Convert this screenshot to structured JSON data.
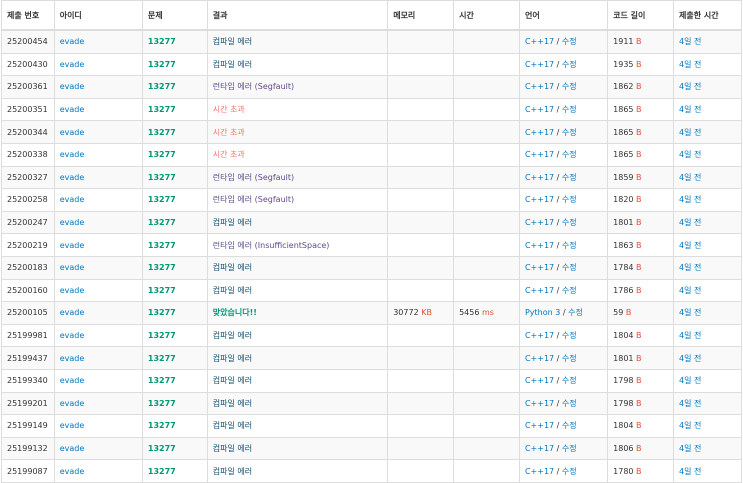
{
  "colors": {
    "compile_error": "#0f4d6d",
    "runtime_error": "#5f4b8b",
    "time_limit": "#fa7268",
    "accepted": "#009874",
    "problem": "#009874",
    "link": "#0076c0",
    "unit": "#e74c3c"
  },
  "headers": [
    "제출 번호",
    "아이디",
    "문제",
    "결과",
    "메모리",
    "시간",
    "언어",
    "코드 길이",
    "제출한 시간"
  ],
  "rows": [
    {
      "id": "25200454",
      "user": "evade",
      "problem": "13277",
      "result": "컴파일 에러",
      "type": "ce",
      "memory": "",
      "memory_unit": "",
      "time": "",
      "time_unit": "",
      "lang": "C++17",
      "edit": "수정",
      "len": "1911",
      "len_unit": "B",
      "ago": "4일 전"
    },
    {
      "id": "25200430",
      "user": "evade",
      "problem": "13277",
      "result": "컴파일 에러",
      "type": "ce",
      "memory": "",
      "memory_unit": "",
      "time": "",
      "time_unit": "",
      "lang": "C++17",
      "edit": "수정",
      "len": "1935",
      "len_unit": "B",
      "ago": "4일 전"
    },
    {
      "id": "25200361",
      "user": "evade",
      "problem": "13277",
      "result": "런타임 에러 (Segfault)",
      "type": "rte",
      "memory": "",
      "memory_unit": "",
      "time": "",
      "time_unit": "",
      "lang": "C++17",
      "edit": "수정",
      "len": "1862",
      "len_unit": "B",
      "ago": "4일 전"
    },
    {
      "id": "25200351",
      "user": "evade",
      "problem": "13277",
      "result": "시간 초과",
      "type": "tle",
      "memory": "",
      "memory_unit": "",
      "time": "",
      "time_unit": "",
      "lang": "C++17",
      "edit": "수정",
      "len": "1865",
      "len_unit": "B",
      "ago": "4일 전"
    },
    {
      "id": "25200344",
      "user": "evade",
      "problem": "13277",
      "result": "시간 초과",
      "type": "tle",
      "memory": "",
      "memory_unit": "",
      "time": "",
      "time_unit": "",
      "lang": "C++17",
      "edit": "수정",
      "len": "1865",
      "len_unit": "B",
      "ago": "4일 전"
    },
    {
      "id": "25200338",
      "user": "evade",
      "problem": "13277",
      "result": "시간 초과",
      "type": "tle",
      "memory": "",
      "memory_unit": "",
      "time": "",
      "time_unit": "",
      "lang": "C++17",
      "edit": "수정",
      "len": "1865",
      "len_unit": "B",
      "ago": "4일 전"
    },
    {
      "id": "25200327",
      "user": "evade",
      "problem": "13277",
      "result": "런타임 에러 (Segfault)",
      "type": "rte",
      "memory": "",
      "memory_unit": "",
      "time": "",
      "time_unit": "",
      "lang": "C++17",
      "edit": "수정",
      "len": "1859",
      "len_unit": "B",
      "ago": "4일 전"
    },
    {
      "id": "25200258",
      "user": "evade",
      "problem": "13277",
      "result": "런타임 에러 (Segfault)",
      "type": "rte",
      "memory": "",
      "memory_unit": "",
      "time": "",
      "time_unit": "",
      "lang": "C++17",
      "edit": "수정",
      "len": "1820",
      "len_unit": "B",
      "ago": "4일 전"
    },
    {
      "id": "25200247",
      "user": "evade",
      "problem": "13277",
      "result": "컴파일 에러",
      "type": "ce",
      "memory": "",
      "memory_unit": "",
      "time": "",
      "time_unit": "",
      "lang": "C++17",
      "edit": "수정",
      "len": "1801",
      "len_unit": "B",
      "ago": "4일 전"
    },
    {
      "id": "25200219",
      "user": "evade",
      "problem": "13277",
      "result": "런타임 에러 (InsufficientSpace)",
      "type": "rte",
      "memory": "",
      "memory_unit": "",
      "time": "",
      "time_unit": "",
      "lang": "C++17",
      "edit": "수정",
      "len": "1863",
      "len_unit": "B",
      "ago": "4일 전"
    },
    {
      "id": "25200183",
      "user": "evade",
      "problem": "13277",
      "result": "컴파일 에러",
      "type": "ce",
      "memory": "",
      "memory_unit": "",
      "time": "",
      "time_unit": "",
      "lang": "C++17",
      "edit": "수정",
      "len": "1784",
      "len_unit": "B",
      "ago": "4일 전"
    },
    {
      "id": "25200160",
      "user": "evade",
      "problem": "13277",
      "result": "컴파일 에러",
      "type": "ce",
      "memory": "",
      "memory_unit": "",
      "time": "",
      "time_unit": "",
      "lang": "C++17",
      "edit": "수정",
      "len": "1786",
      "len_unit": "B",
      "ago": "4일 전"
    },
    {
      "id": "25200105",
      "user": "evade",
      "problem": "13277",
      "result": "맞았습니다!!",
      "type": "ac",
      "memory": "30772",
      "memory_unit": "KB",
      "time": "5456",
      "time_unit": "ms",
      "lang": "Python 3",
      "edit": "수정",
      "len": "59",
      "len_unit": "B",
      "ago": "4일 전"
    },
    {
      "id": "25199981",
      "user": "evade",
      "problem": "13277",
      "result": "컴파일 에러",
      "type": "ce",
      "memory": "",
      "memory_unit": "",
      "time": "",
      "time_unit": "",
      "lang": "C++17",
      "edit": "수정",
      "len": "1804",
      "len_unit": "B",
      "ago": "4일 전"
    },
    {
      "id": "25199437",
      "user": "evade",
      "problem": "13277",
      "result": "컴파일 에러",
      "type": "ce",
      "memory": "",
      "memory_unit": "",
      "time": "",
      "time_unit": "",
      "lang": "C++17",
      "edit": "수정",
      "len": "1801",
      "len_unit": "B",
      "ago": "4일 전"
    },
    {
      "id": "25199340",
      "user": "evade",
      "problem": "13277",
      "result": "컴파일 에러",
      "type": "ce",
      "memory": "",
      "memory_unit": "",
      "time": "",
      "time_unit": "",
      "lang": "C++17",
      "edit": "수정",
      "len": "1798",
      "len_unit": "B",
      "ago": "4일 전"
    },
    {
      "id": "25199201",
      "user": "evade",
      "problem": "13277",
      "result": "컴파일 에러",
      "type": "ce",
      "memory": "",
      "memory_unit": "",
      "time": "",
      "time_unit": "",
      "lang": "C++17",
      "edit": "수정",
      "len": "1798",
      "len_unit": "B",
      "ago": "4일 전"
    },
    {
      "id": "25199149",
      "user": "evade",
      "problem": "13277",
      "result": "컴파일 에러",
      "type": "ce",
      "memory": "",
      "memory_unit": "",
      "time": "",
      "time_unit": "",
      "lang": "C++17",
      "edit": "수정",
      "len": "1804",
      "len_unit": "B",
      "ago": "4일 전"
    },
    {
      "id": "25199132",
      "user": "evade",
      "problem": "13277",
      "result": "컴파일 에러",
      "type": "ce",
      "memory": "",
      "memory_unit": "",
      "time": "",
      "time_unit": "",
      "lang": "C++17",
      "edit": "수정",
      "len": "1806",
      "len_unit": "B",
      "ago": "4일 전"
    },
    {
      "id": "25199087",
      "user": "evade",
      "problem": "13277",
      "result": "컴파일 에러",
      "type": "ce",
      "memory": "",
      "memory_unit": "",
      "time": "",
      "time_unit": "",
      "lang": "C++17",
      "edit": "수정",
      "len": "1780",
      "len_unit": "B",
      "ago": "4일 전"
    }
  ]
}
